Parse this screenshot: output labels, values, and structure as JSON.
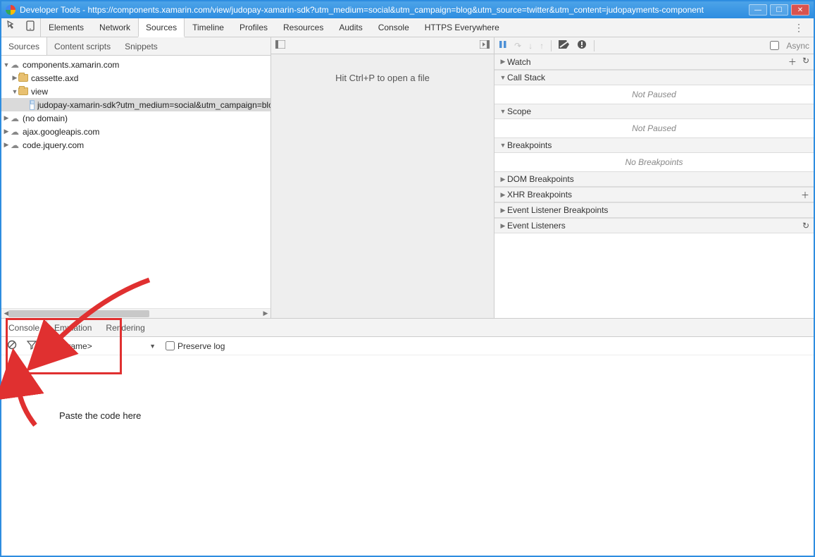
{
  "window": {
    "title": "Developer Tools - https://components.xamarin.com/view/judopay-xamarin-sdk?utm_medium=social&utm_campaign=blog&utm_source=twitter&utm_content=judopayments-component"
  },
  "toolbar": {
    "tabs": [
      "Elements",
      "Network",
      "Sources",
      "Timeline",
      "Profiles",
      "Resources",
      "Audits",
      "Console",
      "HTTPS Everywhere"
    ],
    "active_tab": "Sources"
  },
  "subtabs": {
    "items": [
      "Sources",
      "Content scripts",
      "Snippets"
    ],
    "active": "Sources"
  },
  "nav_tree": {
    "root": "components.xamarin.com",
    "folders": {
      "cassette": "cassette.axd",
      "view": "view",
      "file": "judopay-xamarin-sdk?utm_medium=social&utm_campaign=blog&utm_source=twitter&utm_content=judopayments-component"
    },
    "domains": [
      "(no domain)",
      "ajax.googleapis.com",
      "code.jquery.com"
    ]
  },
  "editor": {
    "hint": "Hit Ctrl+P to open a file"
  },
  "debug": {
    "async_label": "Async",
    "sections": {
      "watch": "Watch",
      "callstack": "Call Stack",
      "scope": "Scope",
      "breakpoints": "Breakpoints",
      "dom": "DOM Breakpoints",
      "xhr": "XHR Breakpoints",
      "listener_bp": "Event Listener Breakpoints",
      "event_listeners": "Event Listeners"
    },
    "not_paused": "Not Paused",
    "no_breakpoints": "No Breakpoints"
  },
  "drawer": {
    "tabs": [
      "Console",
      "Emulation",
      "Rendering"
    ],
    "active": "Console",
    "frame": "<top frame>",
    "preserve_log": "Preserve log"
  },
  "annotations": {
    "paste": "Paste the code here"
  }
}
